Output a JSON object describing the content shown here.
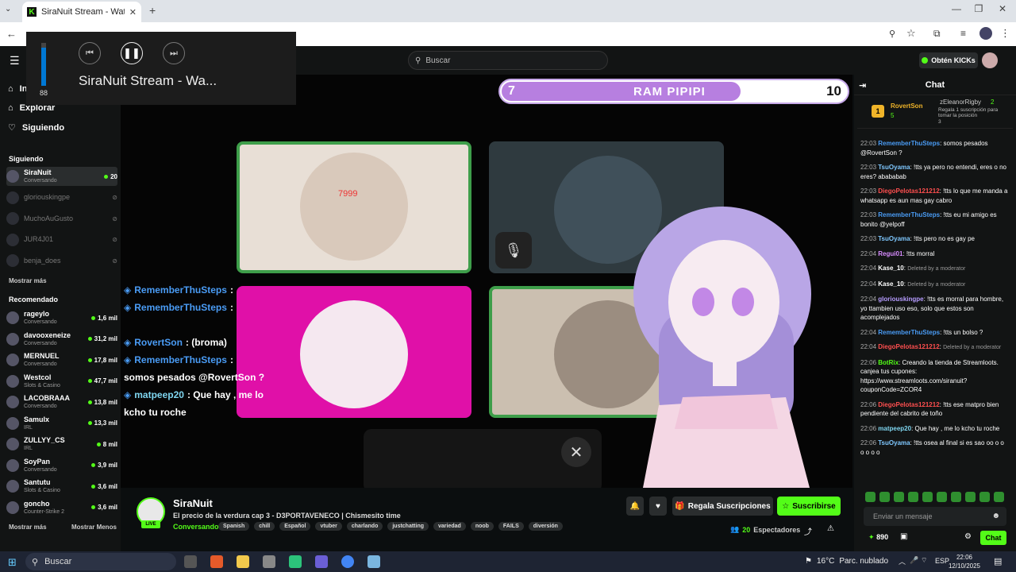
{
  "browser": {
    "tab_title": "SiraNuit Stream - Watch Live o",
    "new_tab": "+",
    "win_min": "—",
    "win_restore": "❐",
    "win_close": "✕"
  },
  "media": {
    "volume": 88,
    "volume_label": "88",
    "title": "SiraNuit Stream - Wa..."
  },
  "header": {
    "search_placeholder": "Buscar",
    "kicks_label": "Obtén KICKs"
  },
  "sidebar": {
    "nav": [
      {
        "label": "Inicio"
      },
      {
        "label": "Explorar"
      },
      {
        "label": "Siguiendo"
      }
    ],
    "following_title": "Siguiendo",
    "following": [
      {
        "name": "SiraNuit",
        "category": "Conversando",
        "viewers": "20",
        "live": true
      },
      {
        "name": "gloriouskingpe",
        "category": "",
        "viewers": "",
        "live": false
      },
      {
        "name": "MuchoAuGusto",
        "category": "",
        "viewers": "",
        "live": false
      },
      {
        "name": "JUR4J01",
        "category": "",
        "viewers": "",
        "live": false
      },
      {
        "name": "benja_does",
        "category": "",
        "viewers": "",
        "live": false
      }
    ],
    "show_more": "Mostrar más",
    "recommended_title": "Recomendado",
    "recommended": [
      {
        "name": "rageylo",
        "category": "Conversando",
        "viewers": "1,6 mil"
      },
      {
        "name": "davooxeneize",
        "category": "Conversando",
        "viewers": "31,2 mil"
      },
      {
        "name": "MERNUEL",
        "category": "Conversando",
        "viewers": "17,8 mil"
      },
      {
        "name": "Westcol",
        "category": "Slots & Casino",
        "viewers": "47,7 mil"
      },
      {
        "name": "LACOBRAAA",
        "category": "Conversando",
        "viewers": "13,8 mil"
      },
      {
        "name": "Samulx",
        "category": "IRL",
        "viewers": "13,3 mil"
      },
      {
        "name": "ZULLYY_CS",
        "category": "IRL",
        "viewers": "8 mil"
      },
      {
        "name": "SoyPan",
        "category": "Conversando",
        "viewers": "3,9 mil"
      },
      {
        "name": "Santutu",
        "category": "Slots & Casino",
        "viewers": "3,6 mil"
      },
      {
        "name": "goncho",
        "category": "Counter-Strike 2",
        "viewers": "3,6 mil"
      }
    ],
    "show_more2": "Mostrar más",
    "show_less": "Mostrar Menos"
  },
  "video": {
    "bar_left": "7",
    "bar_center": "RAM PIPIPI",
    "bar_right": "10",
    "overlay_chat": [
      {
        "user": "RememberThuSteps",
        "text": ":"
      },
      {
        "user": "RememberThuSteps",
        "text": ":"
      },
      {
        "user": "RovertSon",
        "text": ": (broma)"
      },
      {
        "user": "RememberThuSteps",
        "text": ":"
      },
      {
        "user": "",
        "text": "somos pesados @RovertSon ?"
      },
      {
        "user": "matpeep20",
        "text": ": Que hay , me lo"
      },
      {
        "user": "",
        "text": "kcho tu roche"
      }
    ],
    "cam_badge": "7999"
  },
  "channel": {
    "name": "SiraNuit",
    "live_badge": "LIVE",
    "title": "El precio de la verdura cap 3 - D3PORTAVENECO | Chismesito time",
    "category": "Conversando",
    "tags": [
      "Spanish",
      "chill",
      "Español",
      "vtuber",
      "charlando",
      "justchatting",
      "variedad",
      "noob",
      "FAILS",
      "diversión"
    ],
    "gift_label": "Regala Suscripciones",
    "subscribe_label": "Suscribirse",
    "viewers": "20",
    "viewers_label": "Espectadores"
  },
  "chat": {
    "title": "Chat",
    "pinned": {
      "first_name": "RovertSon",
      "first_count": "5",
      "second_name": "zEleanorRigby",
      "second_count": "2",
      "note": "Regala 1 suscripción para tomar la posición",
      "note_num": "3"
    },
    "messages": [
      {
        "time": "22:03",
        "user": "RememberThuSteps",
        "color": "#4a9cf5",
        "text": ": somos pesados @RovertSon ?"
      },
      {
        "time": "22:03",
        "user": "TsuOyama",
        "color": "#7fc8ff",
        "text": ": !tts ya pero no entendi, eres o no eres? abababab"
      },
      {
        "time": "22:03",
        "user": "DiegoPelotas121212",
        "color": "#ff4f4f",
        "text": ": !tts lo que me manda a whatsapp es aun mas gay cabro"
      },
      {
        "time": "22:03",
        "user": "RememberThuSteps",
        "color": "#4a9cf5",
        "text": ": !tts eu mi amigo es bonito @yelpoff"
      },
      {
        "time": "22:03",
        "user": "TsuOyama",
        "color": "#7fc8ff",
        "text": ": !tts pero no es gay pe"
      },
      {
        "time": "22:04",
        "user": "Regui01",
        "color": "#d88cff",
        "text": ": !tts morral"
      },
      {
        "time": "22:04",
        "user": "Kase_10",
        "color": "#ffffff",
        "text": "",
        "deleted": "Deleted by a moderator"
      },
      {
        "time": "22:04",
        "user": "Kase_10",
        "color": "#ffffff",
        "text": "",
        "deleted": "Deleted by a moderator"
      },
      {
        "time": "22:04",
        "user": "gloriouskingpe",
        "color": "#b69cff",
        "text": ": !tts es morral para hombre, yo ttambien uso eso, solo que estos son acomplejados"
      },
      {
        "time": "22:04",
        "user": "RememberThuSteps",
        "color": "#4a9cf5",
        "text": ": !tts un bolso ?"
      },
      {
        "time": "22:04",
        "user": "DiegoPelotas121212",
        "color": "#ff4f4f",
        "text": "",
        "deleted": "Deleted by a moderator"
      },
      {
        "time": "22:06",
        "user": "BotRix",
        "color": "#53fc18",
        "text": ": Creando la tienda de Streamloots. canjea tus cupones: https://www.streamloots.com/siranuit?couponCode=ZCOR4"
      },
      {
        "time": "22:06",
        "user": "DiegoPelotas121212",
        "color": "#ff4f4f",
        "text": ": !tts ese matpro bien pendiente del cabrito de toño"
      },
      {
        "time": "22:06",
        "user": "matpeep20",
        "color": "#7fd6f0",
        "text": ": Que hay , me lo kcho tu roche"
      },
      {
        "time": "22:06",
        "user": "TsuOyama",
        "color": "#7fc8ff",
        "text": ": !tts osea al final si es sao oo o o o o o o"
      }
    ],
    "input_placeholder": "Enviar un mensaje",
    "points": "890",
    "chat_button": "Chat"
  },
  "taskbar": {
    "search": "Buscar",
    "temp": "16°C",
    "weather": "Parc. nublado",
    "lang": "ESP",
    "time": "22:06",
    "date": "12/10/2025"
  }
}
